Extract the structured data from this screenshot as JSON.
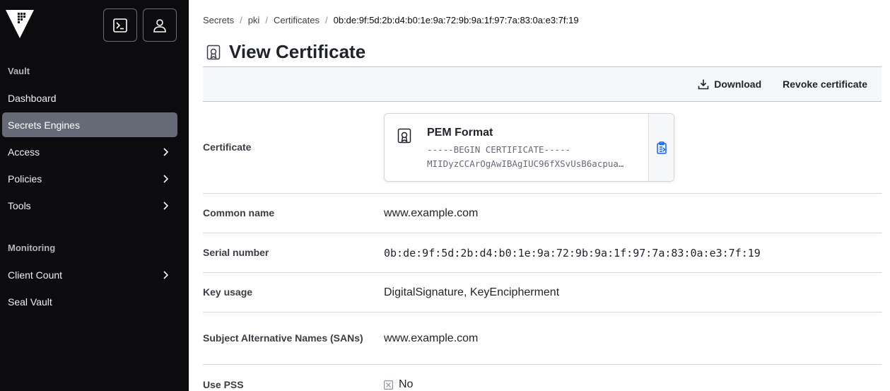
{
  "sidebar": {
    "sections": [
      {
        "heading": "Vault",
        "items": [
          {
            "label": "Dashboard",
            "has_chevron": false,
            "active": false
          },
          {
            "label": "Secrets Engines",
            "has_chevron": false,
            "active": true
          },
          {
            "label": "Access",
            "has_chevron": true,
            "active": false
          },
          {
            "label": "Policies",
            "has_chevron": true,
            "active": false
          },
          {
            "label": "Tools",
            "has_chevron": true,
            "active": false
          }
        ]
      },
      {
        "heading": "Monitoring",
        "items": [
          {
            "label": "Client Count",
            "has_chevron": true,
            "active": false
          },
          {
            "label": "Seal Vault",
            "has_chevron": false,
            "active": false
          }
        ]
      }
    ],
    "top_buttons": [
      "console-icon",
      "user-icon"
    ]
  },
  "breadcrumb": {
    "items": [
      "Secrets",
      "pki",
      "Certificates"
    ],
    "current": "0b:de:9f:5d:2b:d4:b0:1e:9a:72:9b:9a:1f:97:7a:83:0a:e3:7f:19"
  },
  "page": {
    "title": "View Certificate",
    "icon": "certificate-icon"
  },
  "toolbar": {
    "download_label": "Download",
    "revoke_label": "Revoke certificate"
  },
  "details": {
    "certificate_label": "Certificate",
    "pem": {
      "title": "PEM Format",
      "line1": "-----BEGIN CERTIFICATE-----",
      "line2": "MIIDyzCCArOgAwIBAgIUC96fXSvUsB6acpua…"
    },
    "common_name_label": "Common name",
    "common_name": "www.example.com",
    "serial_label": "Serial number",
    "serial": "0b:de:9f:5d:2b:d4:b0:1e:9a:72:9b:9a:1f:97:7a:83:0a:e3:7f:19",
    "key_usage_label": "Key usage",
    "key_usage": "DigitalSignature, KeyEncipherment",
    "sans_label": "Subject Alternative Names (SANs)",
    "sans": "www.example.com",
    "use_pss_label": "Use PSS",
    "use_pss": "No"
  },
  "colors": {
    "sidebar_bg": "#0c0c0e",
    "active_item_bg": "#656a76",
    "copy_icon": "#1060ff"
  }
}
